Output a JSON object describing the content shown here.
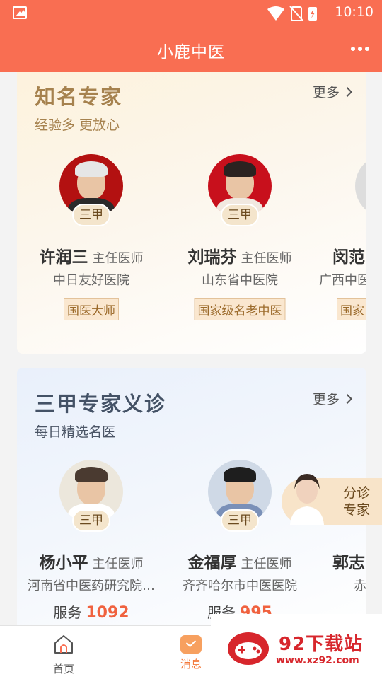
{
  "status_bar": {
    "time": "10:10"
  },
  "app_bar": {
    "title": "小鹿中医"
  },
  "famous_experts": {
    "title": "知名专家",
    "subtitle": "经验多 更放心",
    "more_label": "更多",
    "doctors": [
      {
        "name": "许润三",
        "rank": "主任医师",
        "hospital": "中日友好医院",
        "grade": "三甲",
        "tag": "国医大师"
      },
      {
        "name": "刘瑞芬",
        "rank": "主任医师",
        "hospital": "山东省中医院",
        "grade": "三甲",
        "tag": "国家级名老中医"
      },
      {
        "name": "闵范",
        "hospital": "广西中医",
        "tag": "国家"
      }
    ]
  },
  "clinic_experts": {
    "title": "三甲专家义诊",
    "subtitle": "每日精选名医",
    "more_label": "更多",
    "service_label": "服务",
    "doctors": [
      {
        "name": "杨小平",
        "rank": "主任医师",
        "hospital": "河南省中医药研究院…",
        "grade": "三甲",
        "service_count": "1092"
      },
      {
        "name": "金福厚",
        "rank": "主任医师",
        "hospital": "齐齐哈尔市中医医院",
        "grade": "三甲",
        "service_count": "995"
      },
      {
        "name": "郭志",
        "hospital": "赤"
      }
    ]
  },
  "triage_button": {
    "label_line1": "分诊",
    "label_line2": "专家"
  },
  "tab_bar": {
    "tabs": [
      {
        "label": "首页",
        "icon": "home-icon"
      },
      {
        "label": "消息",
        "icon": "message-icon"
      }
    ]
  },
  "watermark": {
    "title": "92下载站",
    "url": "www.xz92.com"
  },
  "colors": {
    "primary": "#f96e52",
    "gold": "#a6824e",
    "accent_orange": "#f0623f"
  }
}
